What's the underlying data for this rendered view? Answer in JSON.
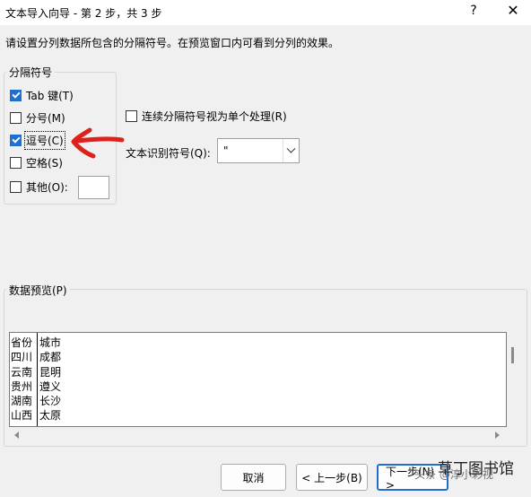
{
  "window": {
    "title": "文本导入向导 - 第 2 步，共 3 步",
    "help_glyph": "?",
    "close_glyph": "✕"
  },
  "instruction": "请设置分列数据所包含的分隔符号。在预览窗口内可看到分列的效果。",
  "delimiters": {
    "group_title": "分隔符号",
    "items": [
      {
        "label": "Tab 键(T)",
        "checked": true
      },
      {
        "label": "分号(M)",
        "checked": false
      },
      {
        "label": "逗号(C)",
        "checked": true
      },
      {
        "label": "空格(S)",
        "checked": false
      },
      {
        "label": "其他(O):",
        "checked": false
      }
    ],
    "other_value": ""
  },
  "consecutive": {
    "label": "连续分隔符号视为单个处理(R)",
    "checked": false
  },
  "text_qualifier": {
    "label": "文本识别符号(Q):",
    "value": "\""
  },
  "preview": {
    "group_title": "数据预览(P)",
    "columns": [
      [
        "省份",
        "四川",
        "云南",
        "贵州",
        "湖南",
        "山西"
      ],
      [
        "城市",
        "成都",
        "昆明",
        "遵义",
        "长沙",
        "太原"
      ]
    ]
  },
  "buttons": {
    "cancel": "取消",
    "back": "< 上一步(B)",
    "next": "下一步(N) >"
  },
  "annotation_color": "#e0201c",
  "watermark": {
    "small": "头条 @淳小彩视",
    "large": "草丁图书馆"
  }
}
